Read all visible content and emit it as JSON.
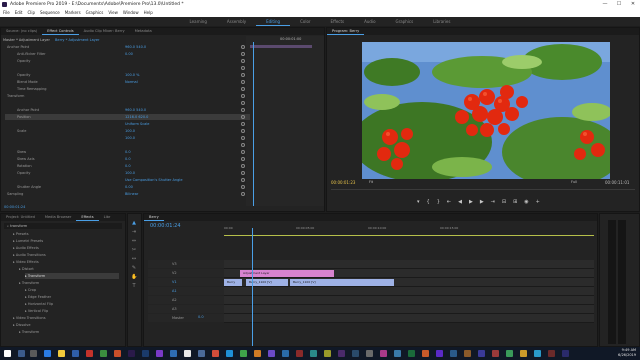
{
  "window": {
    "title": "Adobe Premiere Pro 2019 - E:\\Documents\\Adobe\\Premiere Pro\\13.0\\Untitled *",
    "controls": [
      "—",
      "☐",
      "✕"
    ]
  },
  "menu": [
    "File",
    "Edit",
    "Clip",
    "Sequence",
    "Markers",
    "Graphics",
    "View",
    "Window",
    "Help"
  ],
  "workspaces": [
    {
      "label": "Learning",
      "active": false
    },
    {
      "label": "Assembly",
      "active": false
    },
    {
      "label": "Editing",
      "active": true
    },
    {
      "label": "Color",
      "active": false
    },
    {
      "label": "Effects",
      "active": false
    },
    {
      "label": "Audio",
      "active": false
    },
    {
      "label": "Graphics",
      "active": false
    },
    {
      "label": "Libraries",
      "active": false
    }
  ],
  "source_panel": {
    "tabs": [
      "Source: (no clips)",
      "Effect Controls",
      "Audio Clip Mixer: Berry",
      "Metadata"
    ],
    "active_tab": 1,
    "clip_header": "Master * Adjustment Layer",
    "sequence_header": "Berry * Adjustment Layer",
    "timecode": "00:00:01:00",
    "rows": [
      {
        "label": "Anchor Point",
        "value": "960.0   540.0",
        "sel": false
      },
      {
        "label": "Anti-flicker Filter",
        "value": "0.00",
        "sel": false
      },
      {
        "label": "Opacity",
        "value": "",
        "sel": false
      },
      {
        "label": "",
        "value": "",
        "sel": false
      },
      {
        "label": "Opacity",
        "value": "100.0 %",
        "sel": false
      },
      {
        "label": "Blend Mode",
        "value": "Normal",
        "sel": false
      },
      {
        "label": "Time Remapping",
        "value": "",
        "sel": false
      },
      {
        "label": "Transform",
        "value": "",
        "sel": false
      },
      {
        "label": "",
        "value": "",
        "sel": false
      },
      {
        "label": "Anchor Point",
        "value": "960.0   540.0",
        "sel": false
      },
      {
        "label": "Position",
        "value": "1216.0   620.0",
        "sel": true
      },
      {
        "label": "",
        "value": "Uniform Scale",
        "sel": false
      },
      {
        "label": "Scale",
        "value": "100.0",
        "sel": false
      },
      {
        "label": "",
        "value": "100.0",
        "sel": false
      },
      {
        "label": "",
        "value": "",
        "sel": false
      },
      {
        "label": "Skew",
        "value": "0.0",
        "sel": false
      },
      {
        "label": "Skew Axis",
        "value": "0.0",
        "sel": false
      },
      {
        "label": "Rotation",
        "value": "0.0",
        "sel": false
      },
      {
        "label": "Opacity",
        "value": "100.0",
        "sel": false
      },
      {
        "label": "",
        "value": "Use Composition's Shutter Angle",
        "sel": false
      },
      {
        "label": "Shutter Angle",
        "value": "0.00",
        "sel": false
      },
      {
        "label": "Sampling",
        "value": "Bilinear",
        "sel": false
      }
    ],
    "footer_time": "00:00:01:24"
  },
  "program_panel": {
    "title": "Program: Berry",
    "timecode_left": "00:00:01:23",
    "fit": "Fit",
    "quality": "Full",
    "timecode_right": "00:00:11:01"
  },
  "project_panel": {
    "tabs": [
      "Project: Untitled",
      "Media Browser",
      "Effects",
      "Libr"
    ],
    "active_tab": 2,
    "search": "transform",
    "items": [
      {
        "label": "Presets",
        "indent": 1
      },
      {
        "label": "Lumetri Presets",
        "indent": 1
      },
      {
        "label": "Audio Effects",
        "indent": 1
      },
      {
        "label": "Audio Transitions",
        "indent": 1
      },
      {
        "label": "Video Effects",
        "indent": 1
      },
      {
        "label": "Distort",
        "indent": 2
      },
      {
        "label": "Transform",
        "indent": 3,
        "sel": true
      },
      {
        "label": "Transform",
        "indent": 2
      },
      {
        "label": "Crop",
        "indent": 3
      },
      {
        "label": "Edge Feather",
        "indent": 3
      },
      {
        "label": "Horizontal Flip",
        "indent": 3
      },
      {
        "label": "Vertical Flip",
        "indent": 3
      },
      {
        "label": "Video Transitions",
        "indent": 1
      },
      {
        "label": "Dissolve",
        "indent": 1
      },
      {
        "label": "Transform",
        "indent": 2
      }
    ]
  },
  "timeline": {
    "tab": "Berry",
    "timecode": "00:00:01:24",
    "ruler": [
      "00:00",
      "00:00:05:00",
      "00:00:10:00",
      "00:00:15:00"
    ],
    "tracks": [
      "V3",
      "V2",
      "V1",
      "A1",
      "A2",
      "A3",
      "Master"
    ],
    "master_value": "0.0",
    "clips": [
      {
        "label": "Adjustment Layer",
        "color": "#d783cf",
        "track": 1
      },
      {
        "label": "Berry",
        "color": "#9fb2e6",
        "track": 2
      },
      {
        "label": "Berry_1100 [V]",
        "color": "#9fb2e6",
        "track": 2
      },
      {
        "label": "Berry_1100 [V]",
        "color": "#9fb2e6",
        "track": 2
      }
    ]
  },
  "taskbar": {
    "time": "9:49 AM",
    "date": "6/26/2019"
  }
}
